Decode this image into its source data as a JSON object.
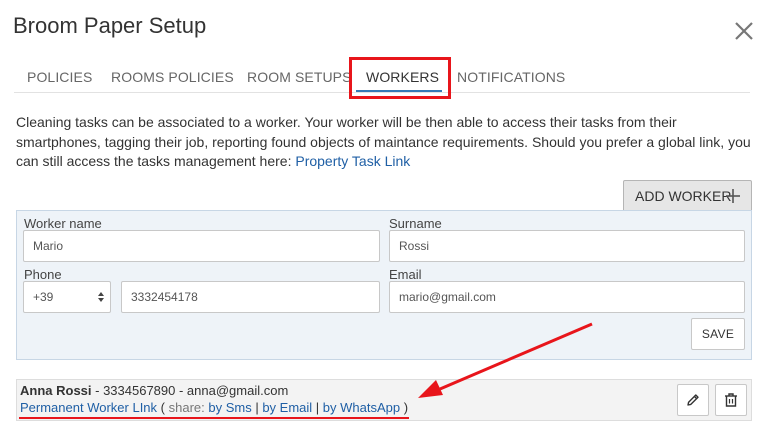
{
  "dialog": {
    "title": "Broom Paper Setup"
  },
  "tabs": [
    {
      "label": "POLICIES"
    },
    {
      "label": "ROOMS POLICIES"
    },
    {
      "label": "ROOM SETUPS"
    },
    {
      "label": "WORKERS"
    },
    {
      "label": "NOTIFICATIONS"
    }
  ],
  "description": {
    "text": "Cleaning tasks can be associated to a worker. Your worker will be then able to access their tasks from their smartphones, tagging their job, reporting found objects of maintance requirements. Should you prefer a global link, you can still access the tasks management here: ",
    "link": "Property Task Link"
  },
  "toolbar": {
    "add_worker_label": "ADD WORKER"
  },
  "form": {
    "worker_name_label": "Worker name",
    "worker_name_value": "Mario",
    "surname_label": "Surname",
    "surname_value": "Rossi",
    "phone_label": "Phone",
    "phone_prefix": "+39",
    "phone_value": "3332454178",
    "email_label": "Email",
    "email_value": "mario@gmail.com",
    "save_label": "SAVE"
  },
  "workers": [
    {
      "name": "Anna Rossi",
      "details": " - 3334567890 - anna@gmail.com",
      "permanent_link": "Permanent Worker LInk",
      "share_open": " ( ",
      "share_label": "share: ",
      "by_sms": "by Sms",
      "sep1": " | ",
      "by_email": "by Email",
      "sep2": " | ",
      "by_whatsapp": "by WhatsApp",
      "share_close": " )"
    }
  ],
  "colors": {
    "annotation_red": "#e8151b",
    "link_blue": "#1f5fa5",
    "tab_underline": "#337ab7"
  }
}
